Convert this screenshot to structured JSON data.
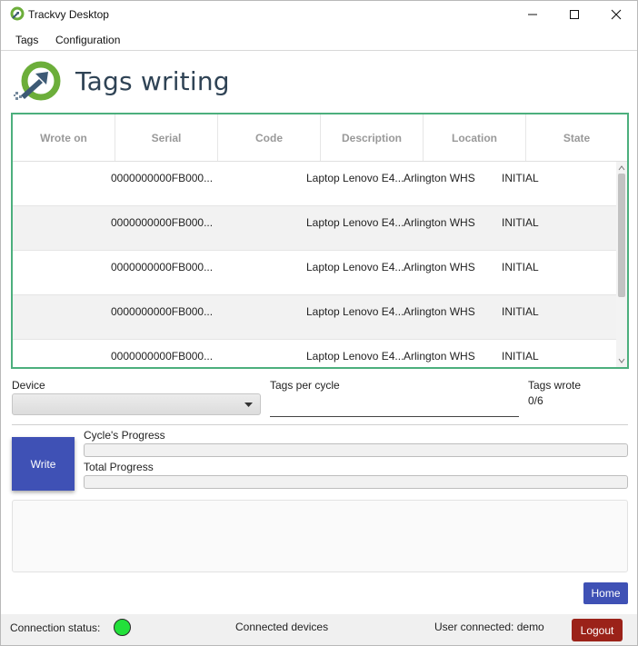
{
  "window": {
    "title": "Trackvy Desktop"
  },
  "menu": {
    "items": [
      "Tags",
      "Configuration"
    ]
  },
  "header": {
    "title": "Tags writing"
  },
  "table": {
    "columns": [
      "Wrote on",
      "Serial",
      "Code",
      "Description",
      "Location",
      "State"
    ],
    "rows": [
      {
        "wrote_on": "",
        "serial": "0000000000FB000...",
        "code": "",
        "description": "Laptop Lenovo E4...",
        "location": "Arlington WHS",
        "state": "INITIAL"
      },
      {
        "wrote_on": "",
        "serial": "0000000000FB000...",
        "code": "",
        "description": "Laptop Lenovo E4...",
        "location": "Arlington WHS",
        "state": "INITIAL"
      },
      {
        "wrote_on": "",
        "serial": "0000000000FB000...",
        "code": "",
        "description": "Laptop Lenovo E4...",
        "location": "Arlington WHS",
        "state": "INITIAL"
      },
      {
        "wrote_on": "",
        "serial": "0000000000FB000...",
        "code": "",
        "description": "Laptop Lenovo E4...",
        "location": "Arlington WHS",
        "state": "INITIAL"
      },
      {
        "wrote_on": "",
        "serial": "0000000000FB000...",
        "code": "",
        "description": "Laptop Lenovo E4...",
        "location": "Arlington WHS",
        "state": "INITIAL"
      }
    ]
  },
  "form": {
    "device_label": "Device",
    "device_value": "",
    "tags_per_cycle_label": "Tags per cycle",
    "tags_per_cycle_value": "",
    "tags_wrote_label": "Tags wrote",
    "tags_wrote_value": "0/6"
  },
  "actions": {
    "write_label": "Write",
    "home_label": "Home",
    "logout_label": "Logout"
  },
  "progress": {
    "cycle_label": "Cycle's Progress",
    "cycle_fraction": 0,
    "total_label": "Total Progress",
    "total_fraction": 0
  },
  "status": {
    "connection_label": "Connection status:",
    "connection_color": "#22e03a",
    "devices_label": "Connected devices",
    "user_label": "User connected: demo"
  },
  "icons": {
    "app": "trackvy-logo-icon",
    "minimize": "minimize-icon",
    "maximize": "maximize-icon",
    "close": "close-icon",
    "dropdown": "chevron-down-icon"
  },
  "colors": {
    "accent": "#3f51b5",
    "table_border": "#4caf7d",
    "logout": "#9b2219",
    "title": "#2f4355"
  }
}
